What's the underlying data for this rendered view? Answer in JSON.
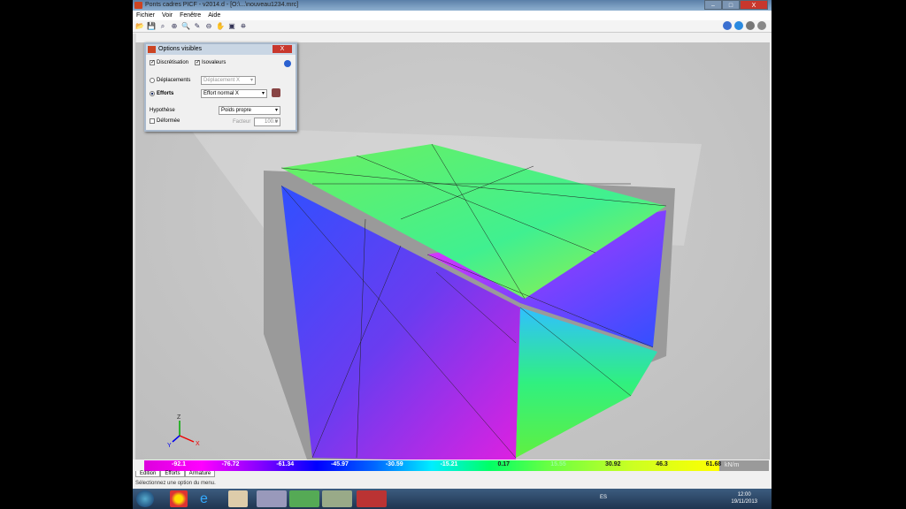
{
  "window": {
    "title": "Ponts cadres PICF - v2014.d - [O:\\...\\nouveau1234.mrc]",
    "minimize": "–",
    "maximize": "□",
    "close": "X"
  },
  "menu": [
    "Fichier",
    "Voir",
    "Fenêtre",
    "Aide"
  ],
  "toolbar": {
    "icons": [
      "open-icon",
      "save-icon",
      "zoom-extents-icon",
      "zoom-window-icon",
      "zoom-icon",
      "pan-icon",
      "zoom-out-icon",
      "hand-icon",
      "view-3d-icon",
      "binoculars-icon"
    ],
    "glyphs": [
      "📂",
      "💾",
      "⌕",
      "⊕",
      "🔍",
      "✎",
      "⊖",
      "✋",
      "▣",
      "⛯"
    ]
  },
  "options_dialog": {
    "title": "Options visibles",
    "close": "X",
    "discretisation": {
      "label": "Discrétisation",
      "checked": true
    },
    "isovaleurs": {
      "label": "Isovaleurs",
      "checked": true
    },
    "deplacements": {
      "label": "Déplacements",
      "selected": false,
      "value": "Déplacement X"
    },
    "efforts": {
      "label": "Efforts",
      "selected": true,
      "value": "Effort normal X"
    },
    "hypothese": {
      "label": "Hypothèse",
      "value": "Poids propre"
    },
    "deformee": {
      "label": "Déformée",
      "checked": false
    },
    "facteur": {
      "label": "Facteur",
      "value": "100.0"
    }
  },
  "legend": {
    "values": [
      "-92.1",
      "-76.72",
      "-61.34",
      "-45.97",
      "-30.59",
      "-15.21",
      "0.17",
      "15.55",
      "30.92",
      "46.3",
      "61.68"
    ],
    "unit": "kN/m",
    "colors": [
      "#ff00ff",
      "#8000ff",
      "#0000ff",
      "#00eeff",
      "#00ff66",
      "#ffff00"
    ]
  },
  "tabs": [
    "Edition",
    "Efforts",
    "Armature"
  ],
  "status": "Sélectionnez une option du menu.",
  "axes": {
    "z": "Z",
    "x": "X",
    "y": "Y"
  },
  "taskbar": {
    "lang": "ES",
    "time": "12:00",
    "date": "19/11/2013"
  }
}
